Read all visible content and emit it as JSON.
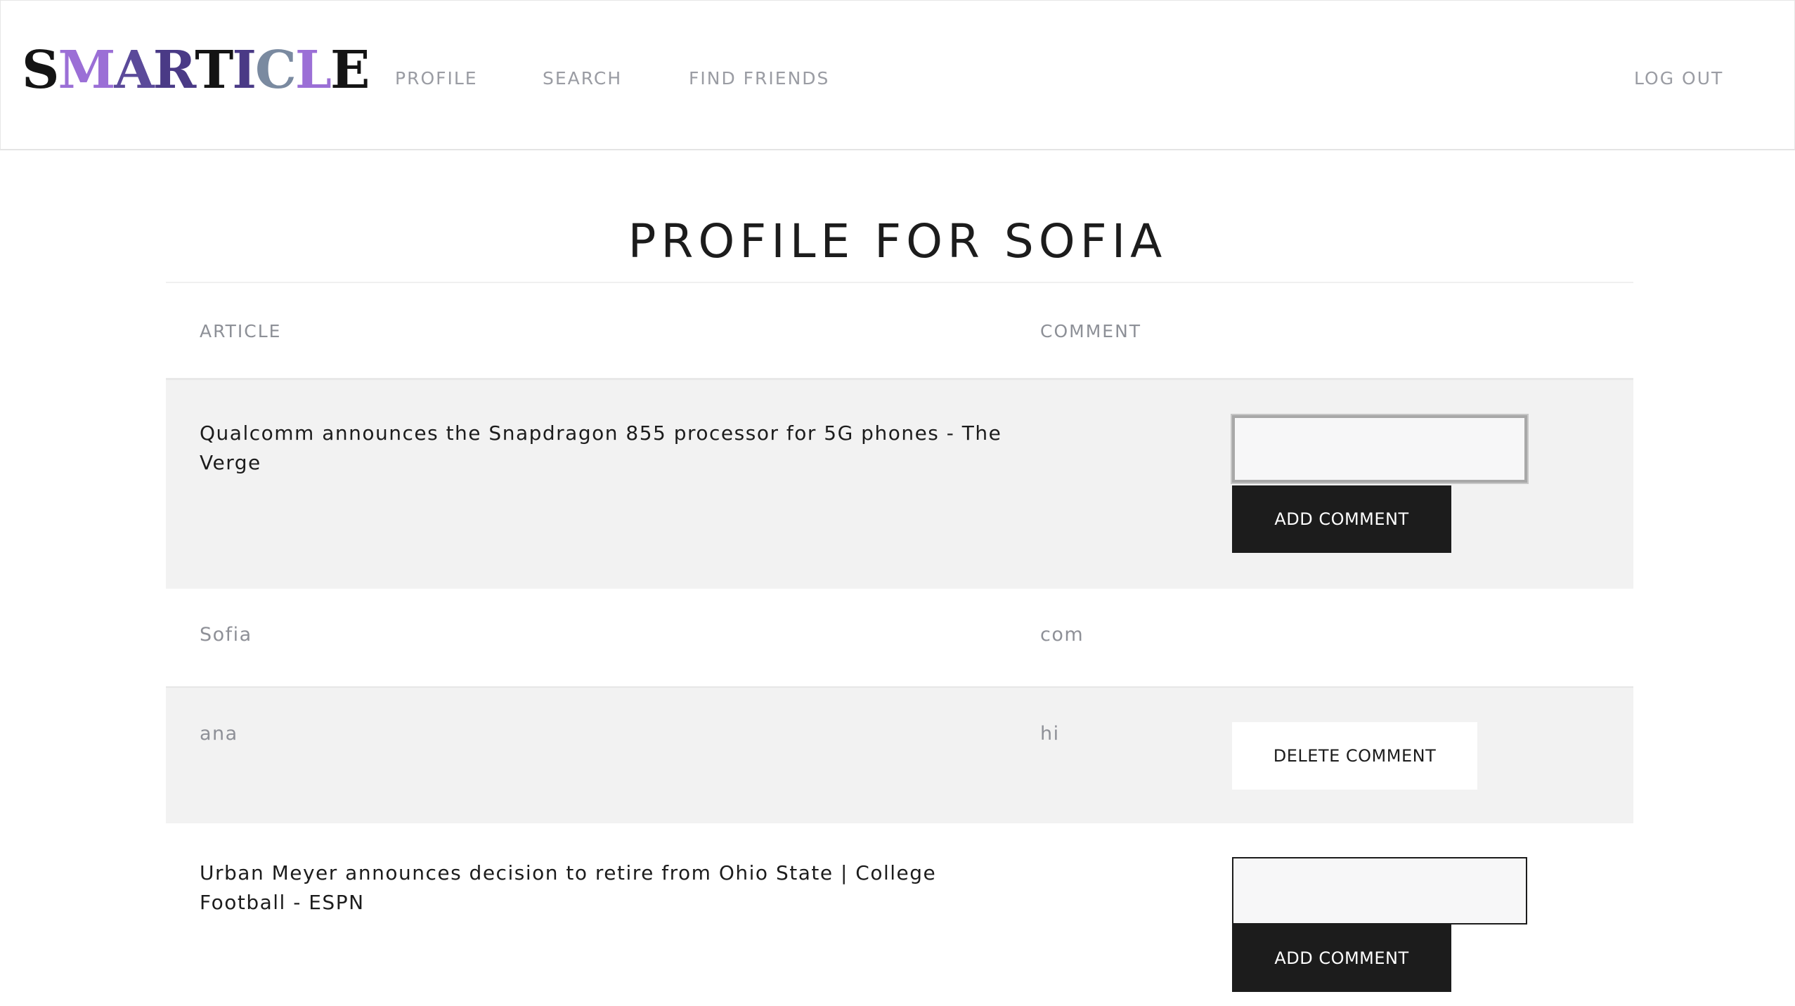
{
  "brand": {
    "letters": [
      {
        "char": "S",
        "color": "#141414"
      },
      {
        "char": "M",
        "color": "#9b6fd6"
      },
      {
        "char": "A",
        "color": "#5b4a9a"
      },
      {
        "char": "R",
        "color": "#4a3a86"
      },
      {
        "char": "T",
        "color": "#141414"
      },
      {
        "char": "I",
        "color": "#4a3a86"
      },
      {
        "char": "C",
        "color": "#7a8aa0"
      },
      {
        "char": "L",
        "color": "#9b6fd6"
      },
      {
        "char": "E",
        "color": "#141414"
      }
    ]
  },
  "nav": {
    "profile": "PROFILE",
    "search": "SEARCH",
    "find_friends": "FIND FRIENDS",
    "logout": "LOG OUT"
  },
  "page": {
    "title": "PROFILE FOR SOFIA"
  },
  "table": {
    "headers": {
      "article": "ARTICLE",
      "comment": "COMMENT"
    },
    "rows": [
      {
        "article": "Qualcomm announces the Snapdragon 855 processor for 5G phones - The Verge",
        "add_label": "ADD COMMENT"
      },
      {
        "user": "Sofia",
        "comment": "com"
      },
      {
        "user": "ana",
        "comment": "hi",
        "delete_label": "DELETE COMMENT"
      },
      {
        "article": "Urban Meyer announces decision to retire from Ohio State | College Football - ESPN",
        "add_label": "ADD COMMENT"
      }
    ]
  },
  "colors": {
    "accent_dark": "#1c1c1c",
    "row_shade": "#f2f2f2",
    "muted_text": "#8e9097"
  }
}
